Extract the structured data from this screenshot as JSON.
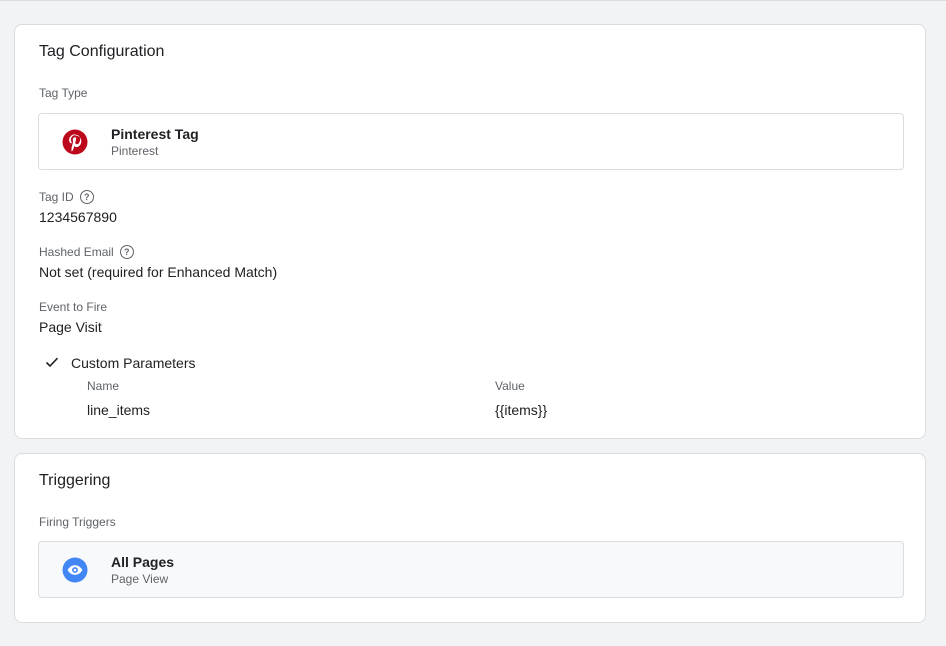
{
  "tag_config": {
    "title": "Tag Configuration",
    "tag_type_label": "Tag Type",
    "tag_type": {
      "name": "Pinterest Tag",
      "vendor": "Pinterest",
      "icon": "pinterest-logo-icon",
      "icon_color": "#bd081c"
    },
    "fields": [
      {
        "label": "Tag ID",
        "value": "1234567890"
      },
      {
        "label": "Hashed Email",
        "value": "Not set (required for Enhanced Match)"
      },
      {
        "label": "Event to Fire",
        "value": "Page Visit"
      }
    ],
    "custom_params": {
      "title": "Custom Parameters",
      "headers": {
        "name": "Name",
        "value": "Value"
      },
      "rows": [
        {
          "name": "line_items",
          "value": "{{items}}"
        }
      ]
    }
  },
  "triggering": {
    "title": "Triggering",
    "firing_label": "Firing Triggers",
    "trigger": {
      "name": "All Pages",
      "type": "Page View",
      "icon": "eye-icon",
      "icon_color": "#4285f4"
    }
  }
}
